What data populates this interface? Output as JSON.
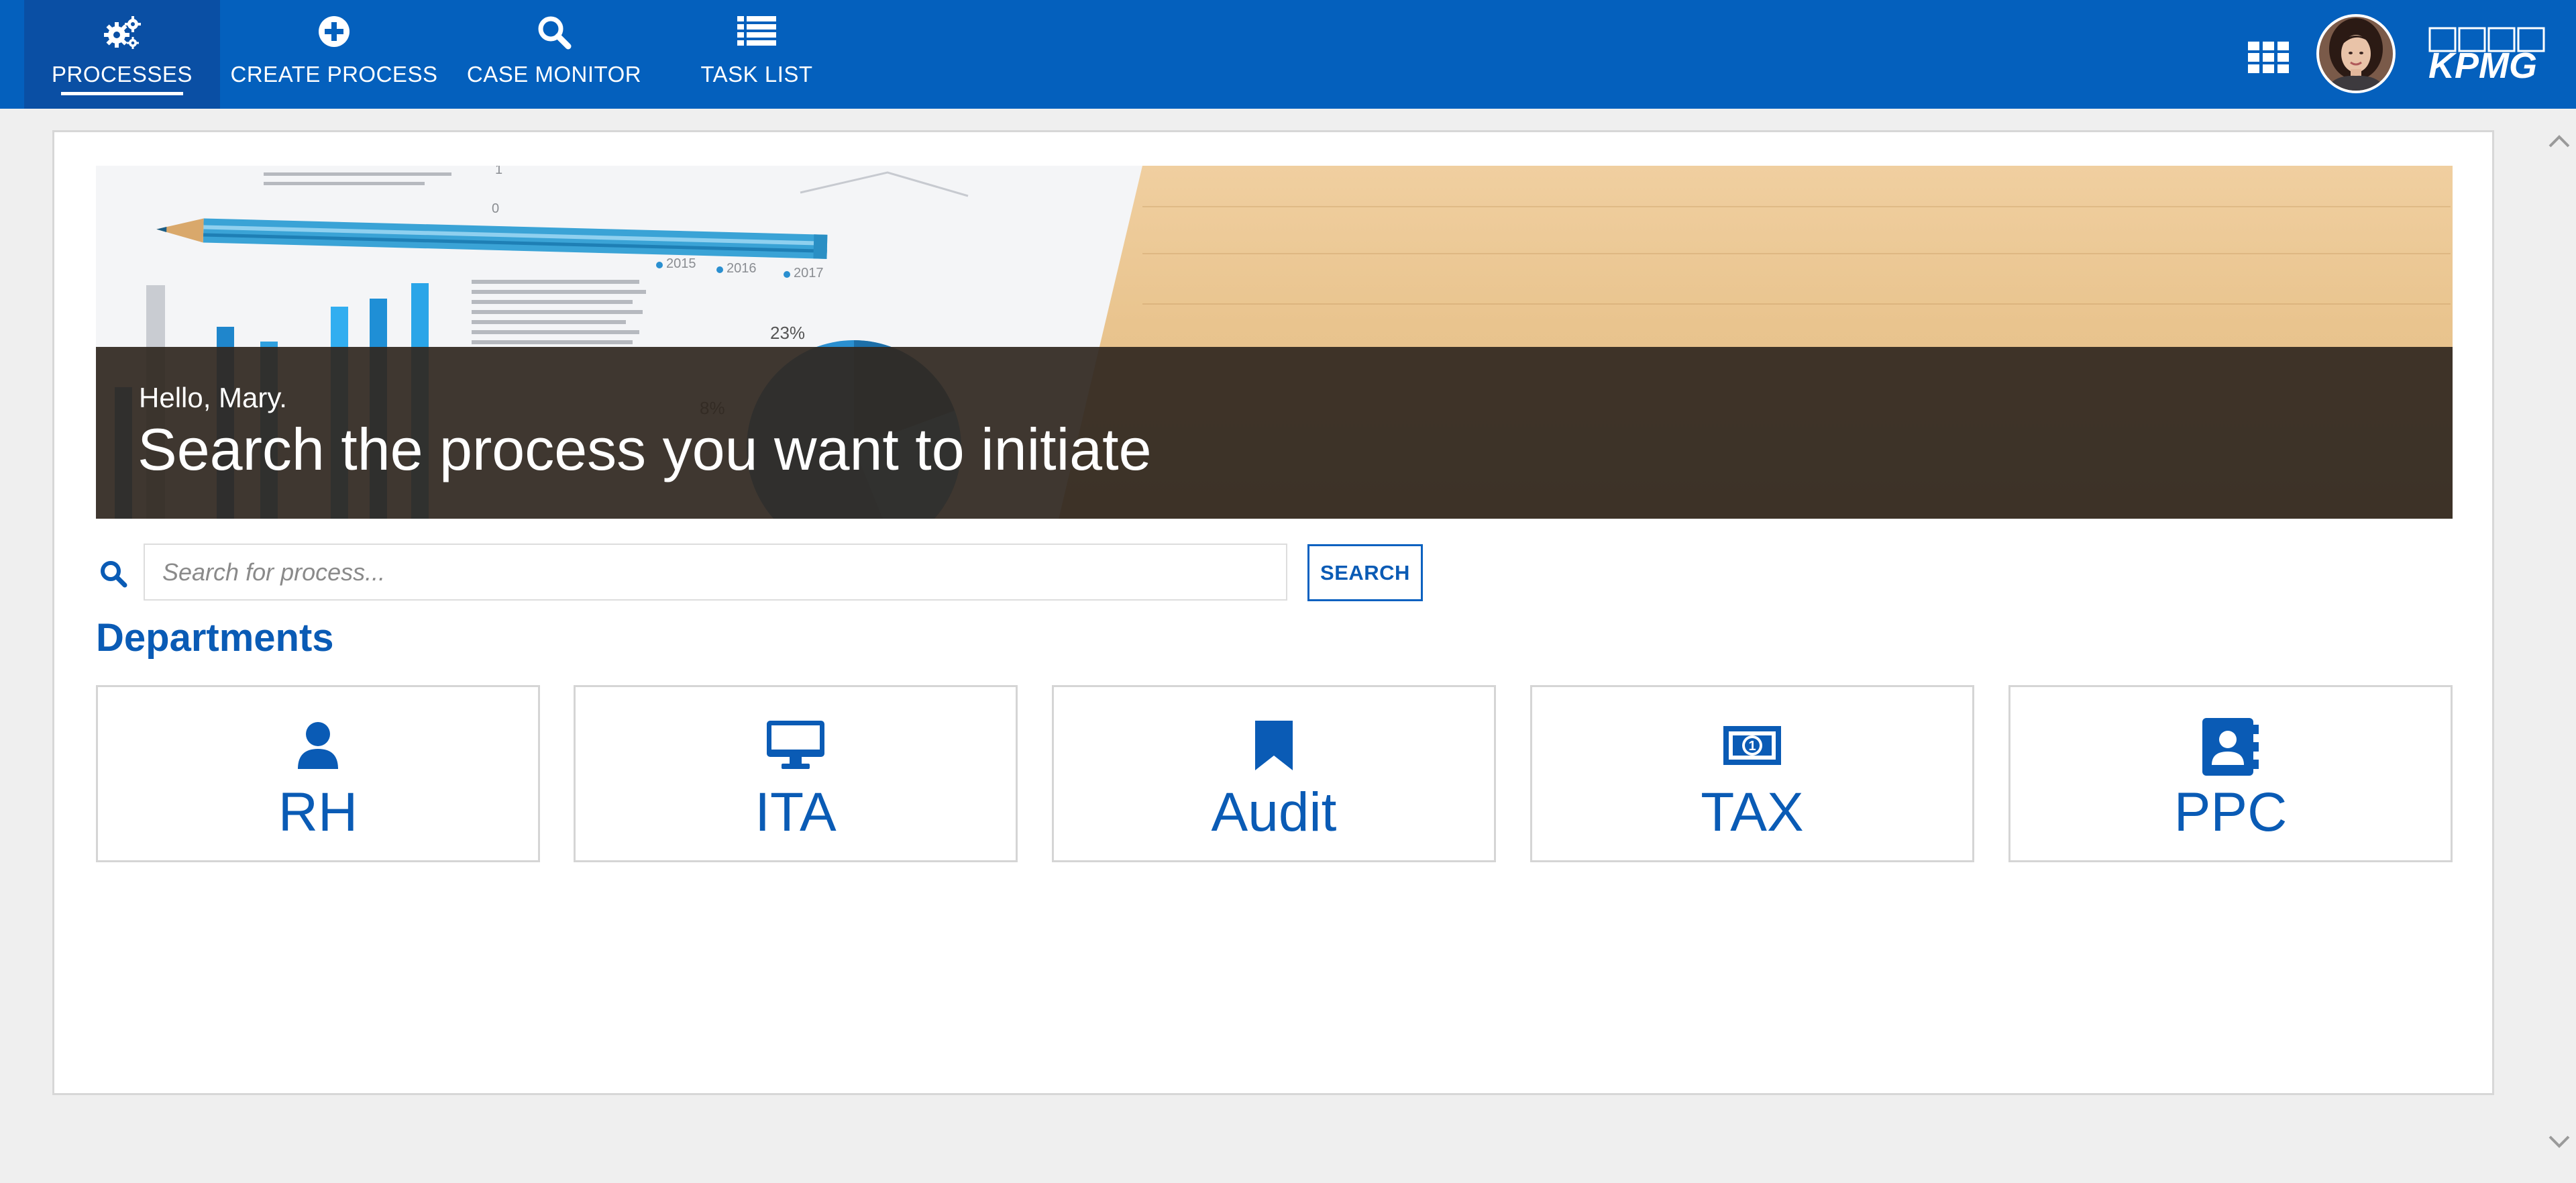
{
  "nav": {
    "items": [
      {
        "label": "PROCESSES",
        "icon": "gears-icon",
        "active": true
      },
      {
        "label": "CREATE PROCESS",
        "icon": "plus-circle-icon"
      },
      {
        "label": "CASE MONITOR",
        "icon": "search-icon"
      },
      {
        "label": "TASK LIST",
        "icon": "list-icon"
      }
    ],
    "brand": "KPMG"
  },
  "hero": {
    "greeting": "Hello, Mary.",
    "headline": "Search the process you want to initiate",
    "paper_labels": [
      "2015",
      "2016",
      "2017",
      "23%",
      "8%",
      "0",
      "1"
    ]
  },
  "search": {
    "placeholder": "Search for process...",
    "value": "",
    "button_label": "SEARCH"
  },
  "departments": {
    "title": "Departments",
    "items": [
      {
        "label": "RH",
        "icon": "user-icon"
      },
      {
        "label": "ITA",
        "icon": "monitor-icon"
      },
      {
        "label": "Audit",
        "icon": "bookmark-icon"
      },
      {
        "label": "TAX",
        "icon": "money-icon"
      },
      {
        "label": "PPC",
        "icon": "contact-book-icon"
      }
    ]
  },
  "colors": {
    "primary": "#0460bd",
    "accent_text": "#0a5bb5",
    "page_bg": "#efefef"
  }
}
